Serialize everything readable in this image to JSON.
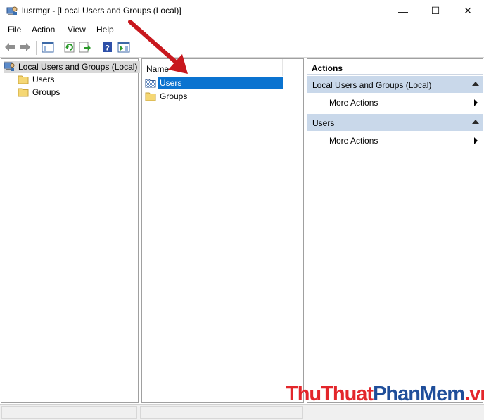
{
  "window": {
    "title": "lusrmgr - [Local Users and Groups (Local)]",
    "min_glyph": "—",
    "max_glyph": "☐",
    "close_glyph": "✕"
  },
  "menu": {
    "items": [
      "File",
      "Action",
      "View",
      "Help"
    ]
  },
  "toolbar": {
    "icons": [
      "back-arrow-icon",
      "forward-arrow-icon",
      "show-hide-tree-icon",
      "refresh-icon",
      "export-list-icon",
      "help-icon",
      "properties-view-icon"
    ]
  },
  "tree": {
    "root": "Local Users and Groups (Local)",
    "items": [
      "Users",
      "Groups"
    ]
  },
  "list": {
    "column_name": "Name",
    "rows": [
      "Users",
      "Groups"
    ],
    "selected": "Users"
  },
  "actions": {
    "title": "Actions",
    "sections": [
      {
        "header": "Local Users and Groups (Local)",
        "item": "More Actions"
      },
      {
        "header": "Users",
        "item": "More Actions"
      }
    ]
  },
  "watermark": {
    "part1": "ThuThuat",
    "part2": "PhanMem",
    "part3": ".vn"
  },
  "colors": {
    "selection": "#0a73d0",
    "section_bg": "#c9d8ea",
    "arrow_red": "#c8181e"
  }
}
